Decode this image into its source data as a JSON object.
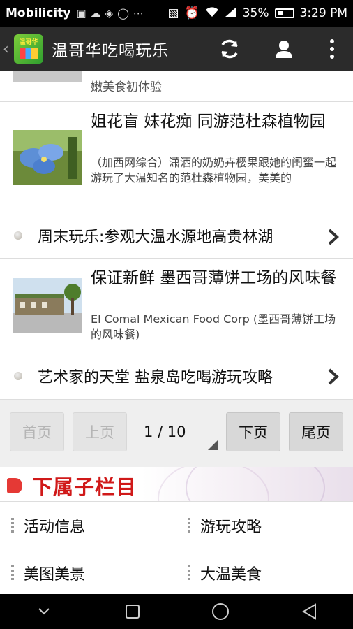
{
  "status_bar": {
    "carrier": "Mobilicity",
    "battery": "35%",
    "time": "3:29 PM"
  },
  "app_bar": {
    "logo_text": "温哥华",
    "title": "温哥华吃喝玩乐"
  },
  "partial_item": {
    "desc": "嫩美食初体验"
  },
  "news_items": [
    {
      "title": "姐花盲 妹花痴 同游范杜森植物园",
      "desc": "（加西网综合）潇洒的奶奶卉樱果跟她的闺蜜一起游玩了大温知名的范杜森植物园，美美的"
    },
    {
      "title": "保证新鲜 墨西哥薄饼工场的风味餐",
      "desc": "El Comal Mexican Food Corp (墨西哥薄饼工场的风味餐)"
    }
  ],
  "link_items": [
    {
      "label": "周末玩乐:参观大温水源地高贵林湖"
    },
    {
      "label": "艺术家的天堂 盐泉岛吃喝游玩攻略"
    }
  ],
  "pager": {
    "first": "首页",
    "prev": "上页",
    "current": "1 / 10",
    "next": "下页",
    "last": "尾页"
  },
  "subcategories": {
    "title": "下属子栏目",
    "items": [
      {
        "label": "活动信息"
      },
      {
        "label": "游玩攻略"
      },
      {
        "label": "美图美景"
      },
      {
        "label": "大温美食"
      }
    ]
  },
  "icons": {
    "refresh": "refresh-icon",
    "profile": "profile-icon",
    "overflow": "overflow-menu-icon",
    "chevron": "chevron-right-icon",
    "nav": [
      "nav-down-icon",
      "recent-apps-icon",
      "home-icon",
      "back-icon"
    ]
  },
  "colors": {
    "app_bar": "#2b2b2b",
    "accent_red": "#d01919",
    "pager_bg": "#efefef"
  }
}
